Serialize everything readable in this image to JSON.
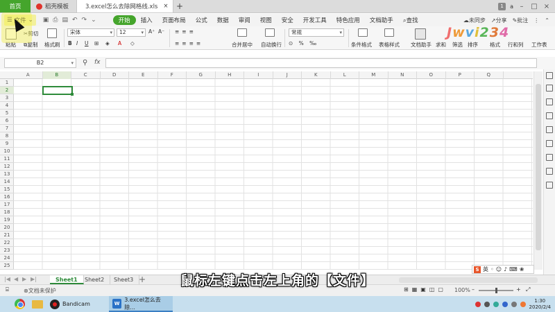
{
  "tabbar": {
    "home": "首页",
    "template": "稻壳模板",
    "file_tab": "3.excel怎么去除网格线.xls",
    "add": "+",
    "badge": "1",
    "user": "a"
  },
  "menubar": {
    "file": "文件",
    "items": [
      "开始",
      "插入",
      "页面布局",
      "公式",
      "数据",
      "审阅",
      "视图",
      "安全",
      "开发工具",
      "特色应用",
      "文档助手"
    ],
    "search": "查找",
    "sync": "未同步",
    "share": "分享",
    "comment": "批注"
  },
  "ribbon": {
    "paste": "粘贴",
    "cut": "剪切",
    "copy": "复制",
    "format_painter": "格式刷",
    "font_name": "宋体",
    "font_size": "12",
    "merge_center": "合并居中",
    "wrap_text": "自动换行",
    "number_format": "常规",
    "conditional": "条件格式",
    "table_style": "表格样式",
    "doc_helper": "文档助手",
    "sum": "求和",
    "filter": "筛选",
    "sort": "排序",
    "format": "格式",
    "row_col": "行和列",
    "worksheet": "工作表",
    "watermark_logo": "Jwvi234"
  },
  "formula": {
    "cell_ref": "B2",
    "fx": "fx"
  },
  "grid": {
    "columns": [
      "A",
      "B",
      "C",
      "D",
      "E",
      "F",
      "G",
      "H",
      "I",
      "J",
      "K",
      "L",
      "M",
      "N",
      "O",
      "P",
      "Q"
    ],
    "rows": [
      "1",
      "2",
      "3",
      "4",
      "5",
      "6",
      "7",
      "8",
      "9",
      "10",
      "11",
      "12",
      "13",
      "14",
      "15",
      "16",
      "17",
      "18",
      "19",
      "20",
      "21",
      "22",
      "23",
      "24",
      "25"
    ],
    "selected_col": "B",
    "selected_row": "2"
  },
  "sheets": {
    "tabs": [
      "Sheet1",
      "Sheet2",
      "Sheet3"
    ],
    "active": "Sheet1",
    "add": "+"
  },
  "status": {
    "protect": "文档未保护",
    "zoom": "100%"
  },
  "subtitle": "鼠标左键点击左上角的【文件】",
  "ime": {
    "lang": "英"
  },
  "taskbar": {
    "apps": [
      "Bandicam",
      "3.excel怎么去除..."
    ],
    "time": "1:30",
    "date": "2020/2/4"
  },
  "colors": {
    "accent": "#45a52c",
    "selection": "#2e8b3a",
    "taskbar": "#c7dfee"
  }
}
